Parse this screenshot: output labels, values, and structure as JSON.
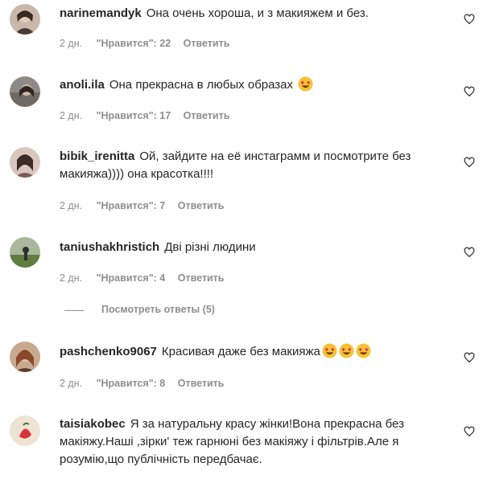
{
  "comments": [
    {
      "username": "narinemandyk",
      "text": "Она очень хороша, и з макияжем и без.",
      "time": "2 дн.",
      "likes": "\"Нравится\": 22",
      "reply": "Ответить"
    },
    {
      "username": "anoli.ila",
      "text": "Она прекрасна в любых образах",
      "time": "2 дн.",
      "likes": "\"Нравится\": 17",
      "reply": "Ответить"
    },
    {
      "username": "bibik_irenitta",
      "text": "Ой, зайдите на её инстаграмм и посмотрите без макияжа)))) она красотка!!!!",
      "time": "2 дн.",
      "likes": "\"Нравится\": 7",
      "reply": "Ответить"
    },
    {
      "username": "taniushakhristich",
      "text": "Дві різні людини",
      "time": "2 дн.",
      "likes": "\"Нравится\": 4",
      "reply": "Ответить"
    },
    {
      "username": "pashchenko9067",
      "text": "Красивая даже без макияжа",
      "time": "2 дн.",
      "likes": "\"Нравится\": 8",
      "reply": "Ответить"
    },
    {
      "username": "taisiakobec",
      "text": "Я за натуральну красу жінки!Вона прекрасна без макіяжу.Наші ,зірки' теж гарнюні без макіяжу і фільтрів.Але я розумію,що публічність передбачає.",
      "time": "",
      "likes": "",
      "reply": ""
    }
  ],
  "view_replies": "Посмотреть ответы (5)",
  "icons": {
    "like": "heart-icon",
    "emoji": "heart-eyes-emoji-icon"
  },
  "colors": {
    "text": "#262626",
    "secondary": "#8e8e8e",
    "background": "#ffffff"
  }
}
